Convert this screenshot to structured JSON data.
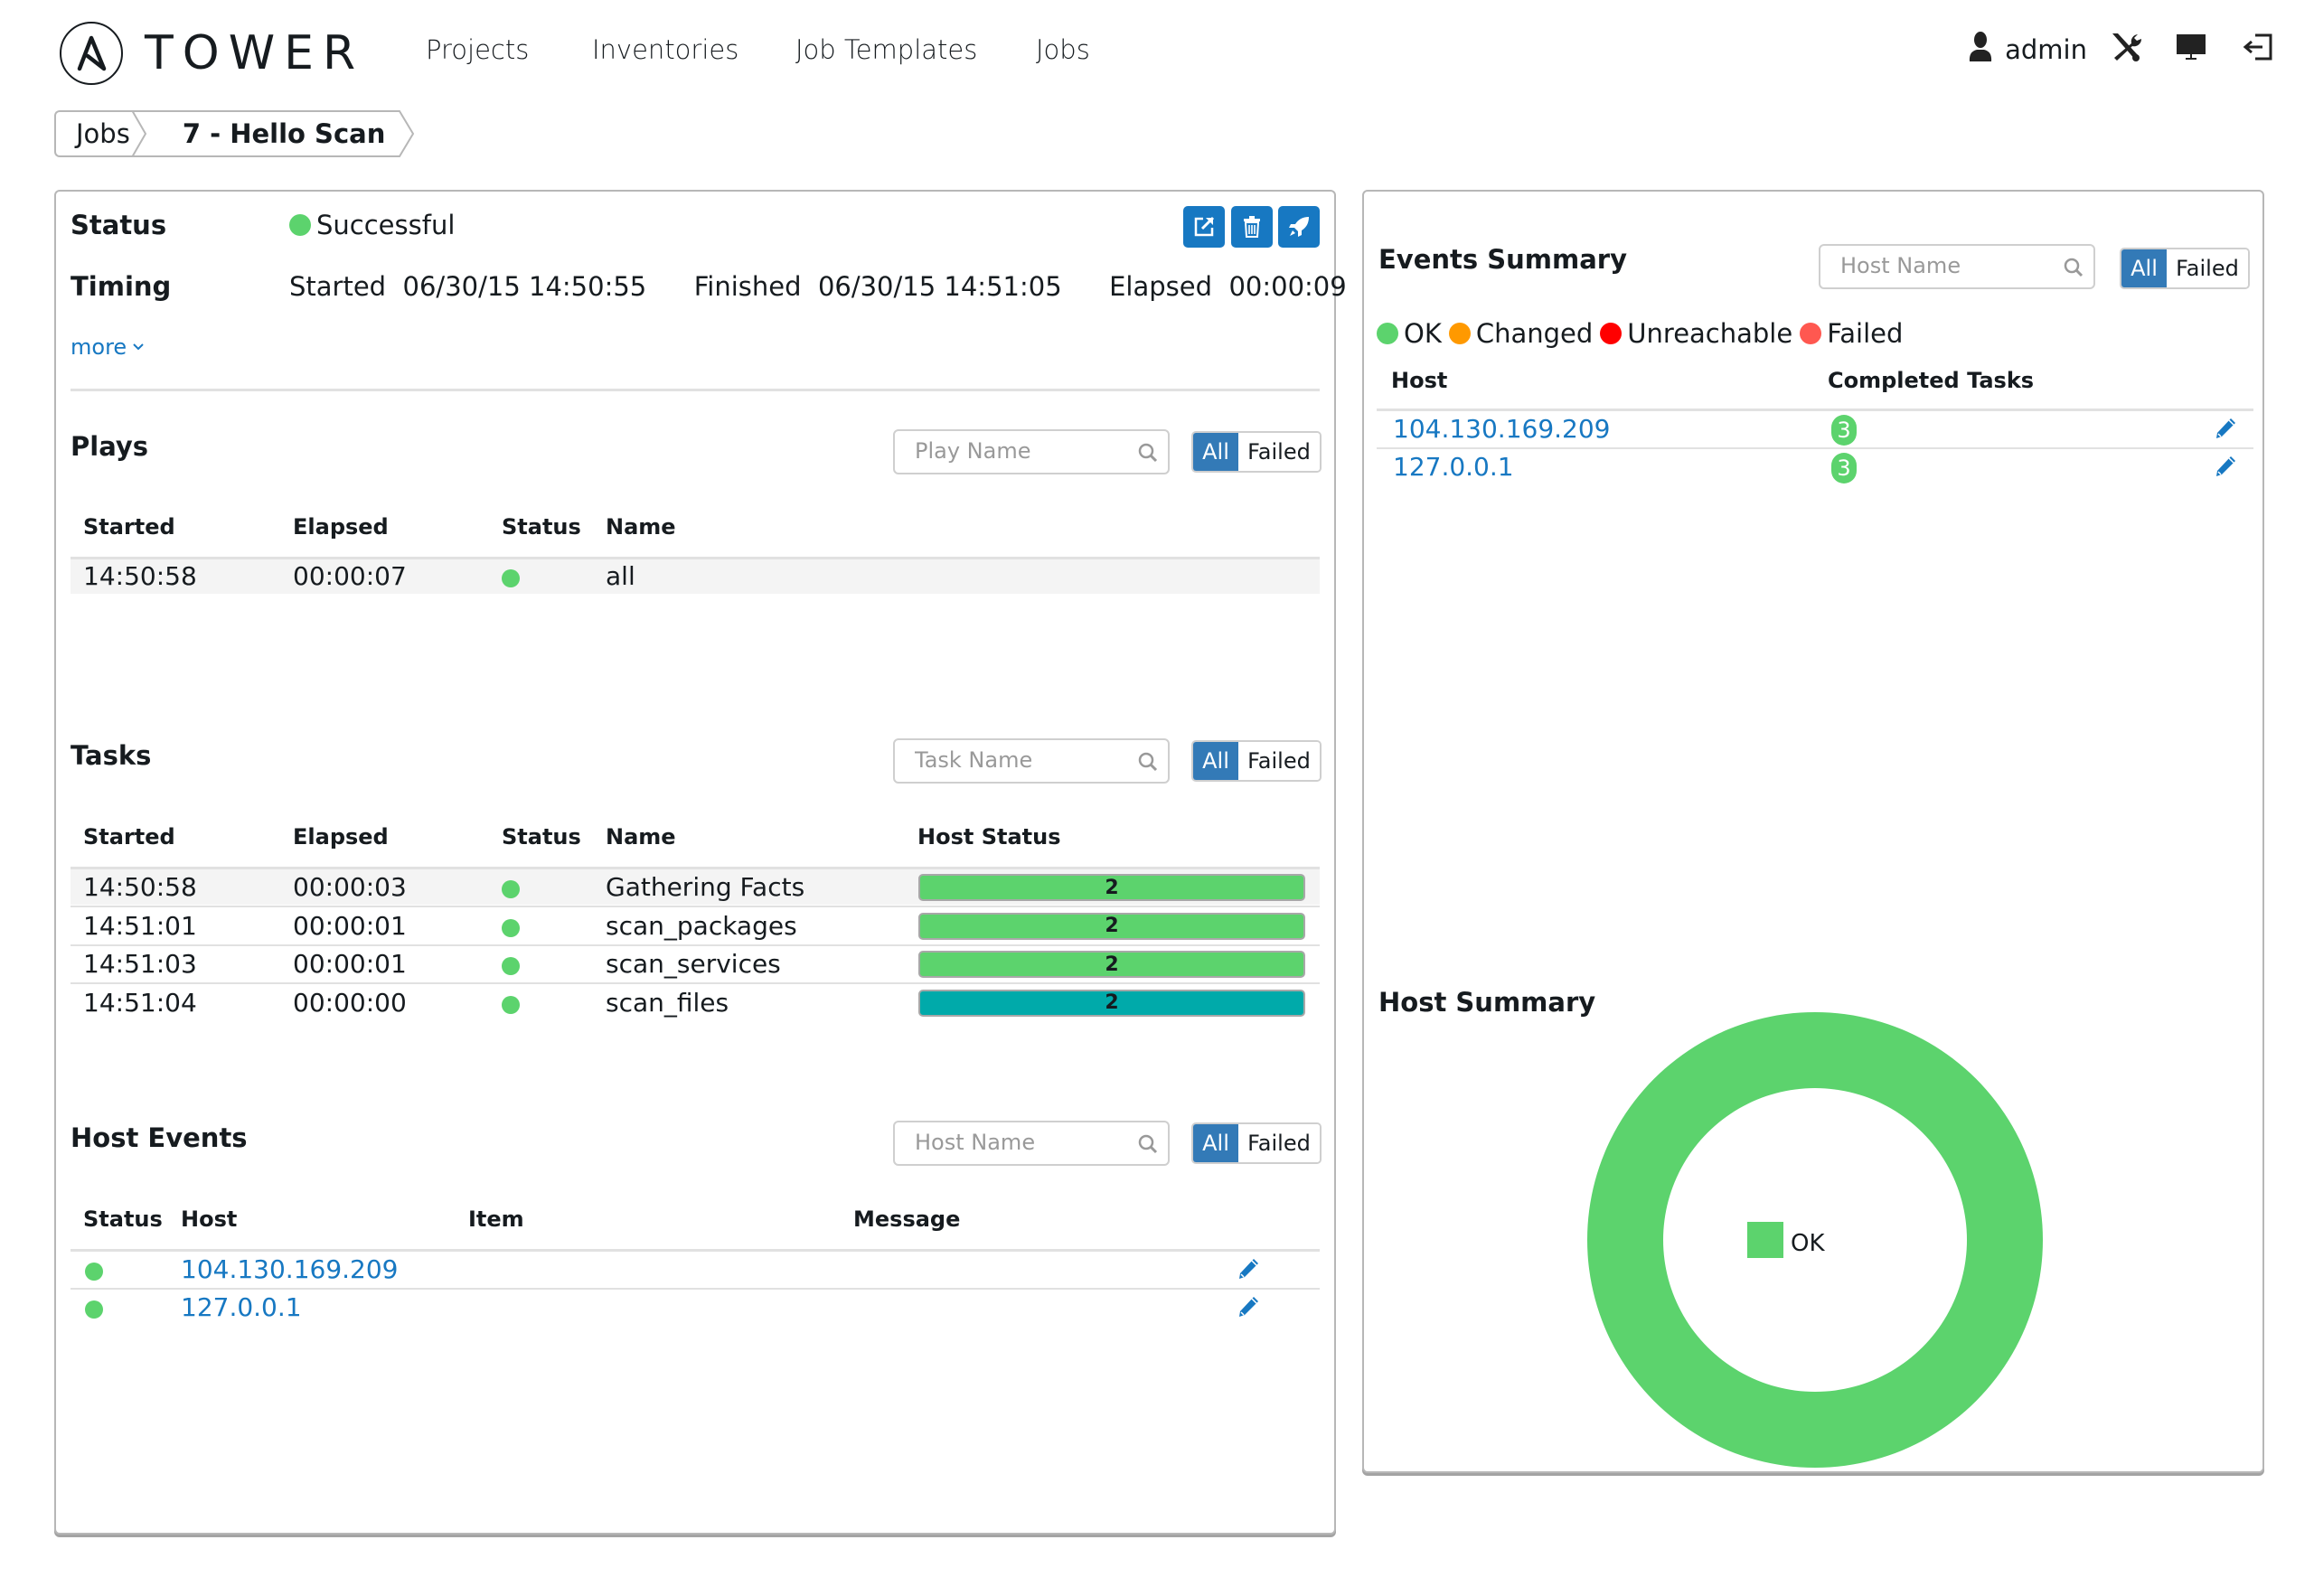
{
  "app": {
    "name": "TOWER"
  },
  "nav": {
    "items": [
      {
        "label": "Projects"
      },
      {
        "label": "Inventories"
      },
      {
        "label": "Job Templates"
      },
      {
        "label": "Jobs"
      }
    ],
    "user": {
      "name": "admin",
      "icon": "user-icon"
    },
    "icons": [
      "settings-tools-icon",
      "monitor-icon",
      "logout-icon"
    ]
  },
  "breadcrumb": {
    "items": [
      {
        "label": "Jobs"
      },
      {
        "label": "7 - Hello Scan"
      }
    ]
  },
  "job": {
    "status_label": "Status",
    "status_value": "Successful",
    "status_color": "#5cd36d",
    "timing_label": "Timing",
    "started_label": "Started",
    "started_value": "06/30/15 14:50:55",
    "finished_label": "Finished",
    "finished_value": "06/30/15 14:51:05",
    "elapsed_label": "Elapsed",
    "elapsed_value": "00:00:09",
    "more_label": "more",
    "actions": [
      "external-link-icon",
      "trash-icon",
      "rocket-icon"
    ]
  },
  "filter": {
    "all_label": "All",
    "failed_label": "Failed"
  },
  "plays": {
    "title": "Plays",
    "search_placeholder": "Play Name",
    "columns": [
      "Started",
      "Elapsed",
      "Status",
      "Name"
    ],
    "rows": [
      {
        "started": "14:50:58",
        "elapsed": "00:00:07",
        "status": "ok",
        "name": "all"
      }
    ]
  },
  "tasks": {
    "title": "Tasks",
    "search_placeholder": "Task Name",
    "columns": [
      "Started",
      "Elapsed",
      "Status",
      "Name",
      "Host Status"
    ],
    "rows": [
      {
        "started": "14:50:58",
        "elapsed": "00:00:03",
        "status": "ok",
        "name": "Gathering Facts",
        "host_count": "2",
        "bar_color": "#5cd36d"
      },
      {
        "started": "14:51:01",
        "elapsed": "00:00:01",
        "status": "ok",
        "name": "scan_packages",
        "host_count": "2",
        "bar_color": "#5cd36d"
      },
      {
        "started": "14:51:03",
        "elapsed": "00:00:01",
        "status": "ok",
        "name": "scan_services",
        "host_count": "2",
        "bar_color": "#5cd36d"
      },
      {
        "started": "14:51:04",
        "elapsed": "00:00:00",
        "status": "ok",
        "name": "scan_files",
        "host_count": "2",
        "bar_color": "#00aaaa"
      }
    ]
  },
  "host_events": {
    "title": "Host Events",
    "search_placeholder": "Host Name",
    "columns": [
      "Status",
      "Host",
      "Item",
      "Message"
    ],
    "rows": [
      {
        "status": "ok",
        "host": "104.130.169.209",
        "item": "",
        "message": ""
      },
      {
        "status": "ok",
        "host": "127.0.0.1",
        "item": "",
        "message": ""
      }
    ]
  },
  "events_summary": {
    "title": "Events Summary",
    "search_placeholder": "Host Name",
    "legend": [
      {
        "label": "OK",
        "color": "#5cd36d"
      },
      {
        "label": "Changed",
        "color": "#ff9900"
      },
      {
        "label": "Unreachable",
        "color": "#ff0000"
      },
      {
        "label": "Failed",
        "color": "#ff5850"
      }
    ],
    "columns": [
      "Host",
      "Completed Tasks"
    ],
    "rows": [
      {
        "host": "104.130.169.209",
        "completed": "3"
      },
      {
        "host": "127.0.0.1",
        "completed": "3"
      }
    ]
  },
  "host_summary": {
    "title": "Host Summary"
  },
  "chart_data": {
    "type": "pie",
    "title": "Host Summary",
    "donut": true,
    "categories": [
      "OK"
    ],
    "values": [
      2
    ],
    "colors": [
      "#5cd36d"
    ],
    "legend": [
      "OK"
    ],
    "legend_placement": "center"
  }
}
